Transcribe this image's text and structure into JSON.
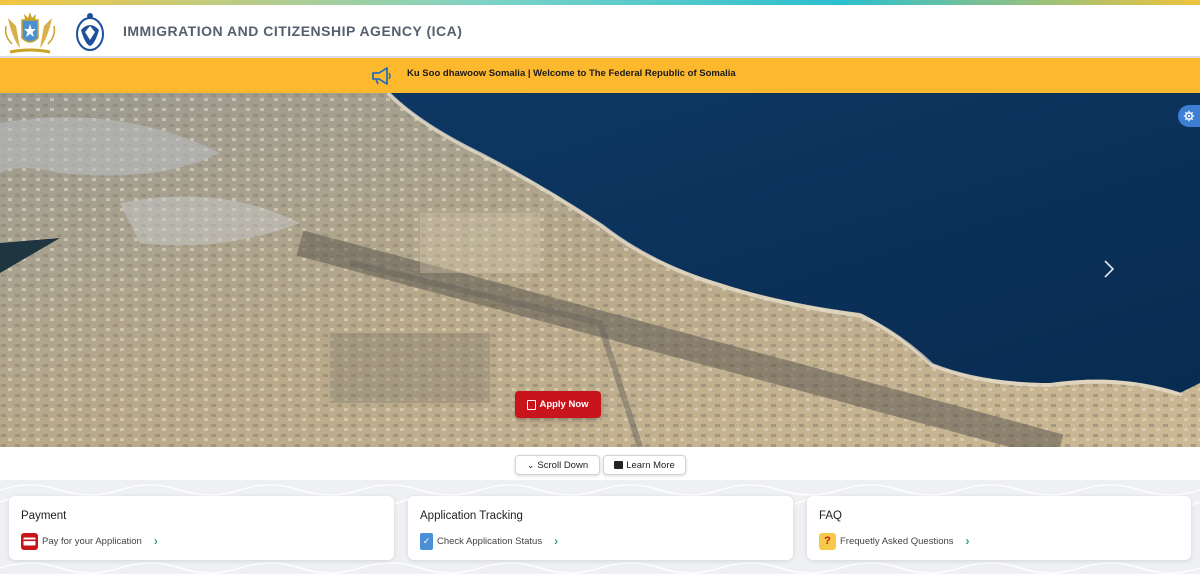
{
  "header": {
    "title": "IMMIGRATION AND CITIZENSHIP AGENCY (ICA)",
    "logos": [
      "somalia-coat-of-arms",
      "ica-emblem"
    ]
  },
  "banner": {
    "icon": "megaphone-icon",
    "text": "Ku Soo dhawoow Somalia | Welcome to The Federal Republic of Somalia",
    "background": "#fdb92e"
  },
  "hero": {
    "apply_label": "Apply Now",
    "next_icon": "chevron-right-icon",
    "settings_icon": "gear-icon"
  },
  "actions": {
    "scroll_label": "Scroll Down",
    "learn_label": "Learn More"
  },
  "cards": [
    {
      "title": "Payment",
      "link": "Pay for your Application",
      "icon": "payment-card-icon"
    },
    {
      "title": "Application Tracking",
      "link": "Check Application Status",
      "icon": "clipboard-icon"
    },
    {
      "title": "FAQ",
      "link": "Frequetly Asked Questions",
      "icon": "question-icon"
    }
  ],
  "colors": {
    "accent_red": "#c8151b",
    "banner_yellow": "#fdb92e",
    "link_chevron": "#2a9d8f"
  }
}
